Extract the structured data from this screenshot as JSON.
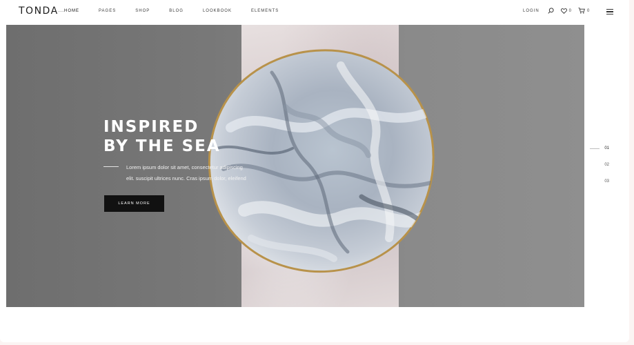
{
  "brand": {
    "logo": "TONDA"
  },
  "nav": {
    "items": [
      "HOME",
      "PAGES",
      "SHOP",
      "BLOG",
      "LOOKBOOK",
      "ELEMENTS"
    ]
  },
  "header": {
    "login_label": "LOGIN",
    "wishlist_count": "0",
    "cart_count": "0"
  },
  "hero": {
    "title_line1": "INSPIRED",
    "title_line2": "BY THE SEA",
    "text_line1": "Lorem ipsum dolor sit amet, consectetur adipiscing",
    "text_line2": "elit. suscipit ultrices nunc. Cras ipsum dolor, eleifend",
    "cta_label": "LEARN MORE"
  },
  "slider": {
    "pages": [
      "01",
      "02",
      "03"
    ],
    "active": "01"
  },
  "colors": {
    "accent": "#111111",
    "hero_bg": "#7a7a7a",
    "plate_rim": "#b8924a"
  }
}
